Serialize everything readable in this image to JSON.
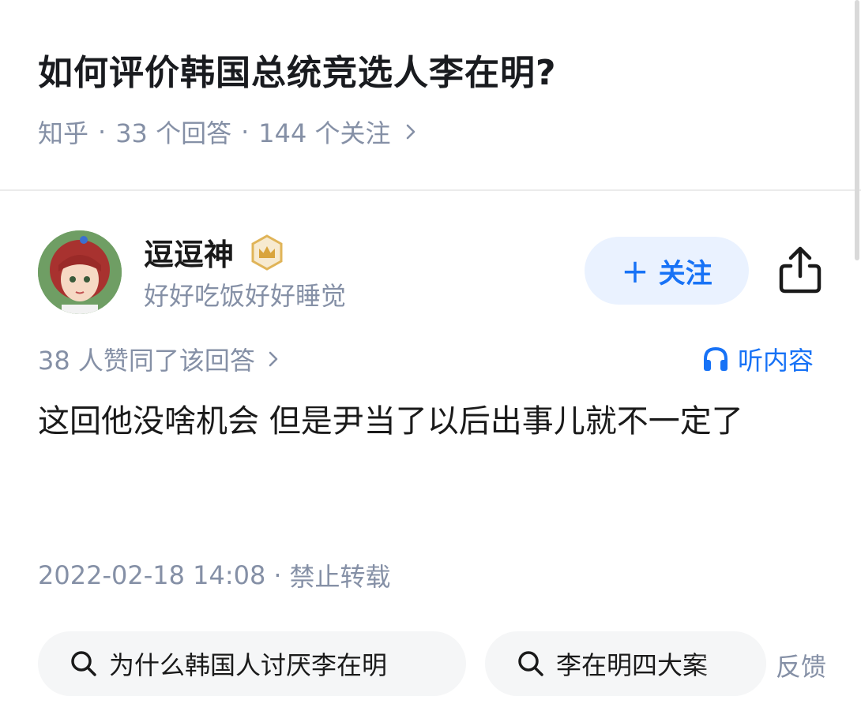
{
  "question": {
    "title": "如何评价韩国总统竞选人李在明?",
    "source": "知乎",
    "answers_count": "33 个回答",
    "followers_count": "144 个关注"
  },
  "author": {
    "name": "逗逗神",
    "bio": "好好吃饭好好睡觉",
    "badge_icon": "crown-badge-icon",
    "follow_label": "关注"
  },
  "answer": {
    "likes": "38 人赞同了该回答",
    "listen_label": "听内容",
    "content": "这回他没啥机会 但是尹当了以后出事儿就不一定了",
    "date": "2022-02-18 14:08",
    "copyright": "禁止转载"
  },
  "related_searches": [
    {
      "label": "为什么韩国人讨厌李在明"
    },
    {
      "label": "李在明四大案"
    }
  ],
  "feedback_label": "反馈",
  "colors": {
    "accent": "#1772f6",
    "muted": "#8590a6",
    "follow_bg": "#eaf2ff",
    "chip_bg": "#f5f6f7",
    "badge": "#e8b44a"
  }
}
